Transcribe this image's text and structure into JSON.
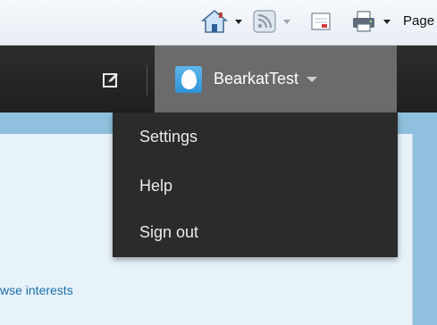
{
  "browser_toolbar": {
    "buttons": [
      {
        "icon": "home-icon",
        "has_menu": true
      },
      {
        "icon": "rss-feed-icon",
        "has_menu": true,
        "disabled": true
      },
      {
        "icon": "read-mail-icon",
        "has_menu": false
      },
      {
        "icon": "print-icon",
        "has_menu": true
      }
    ],
    "page_menu_label": "Page"
  },
  "navbar": {
    "compose_icon": "compose-icon",
    "user": {
      "name": "BearkatTest",
      "avatar_icon": "default-egg-avatar"
    }
  },
  "user_dropdown": {
    "items": [
      "Settings",
      "Help",
      "Sign out"
    ]
  },
  "content": {
    "link_text": "wse interests"
  },
  "colors": {
    "navbar_bg": "#222222",
    "user_menu_active_bg": "#6b6b6b",
    "dropdown_bg": "#2b2b2b",
    "avatar_blue": "#3aa0e0",
    "link_color": "#1b6fa8",
    "content_bg": "#e7f2f9",
    "frame_bg": "#8fc0dd"
  }
}
